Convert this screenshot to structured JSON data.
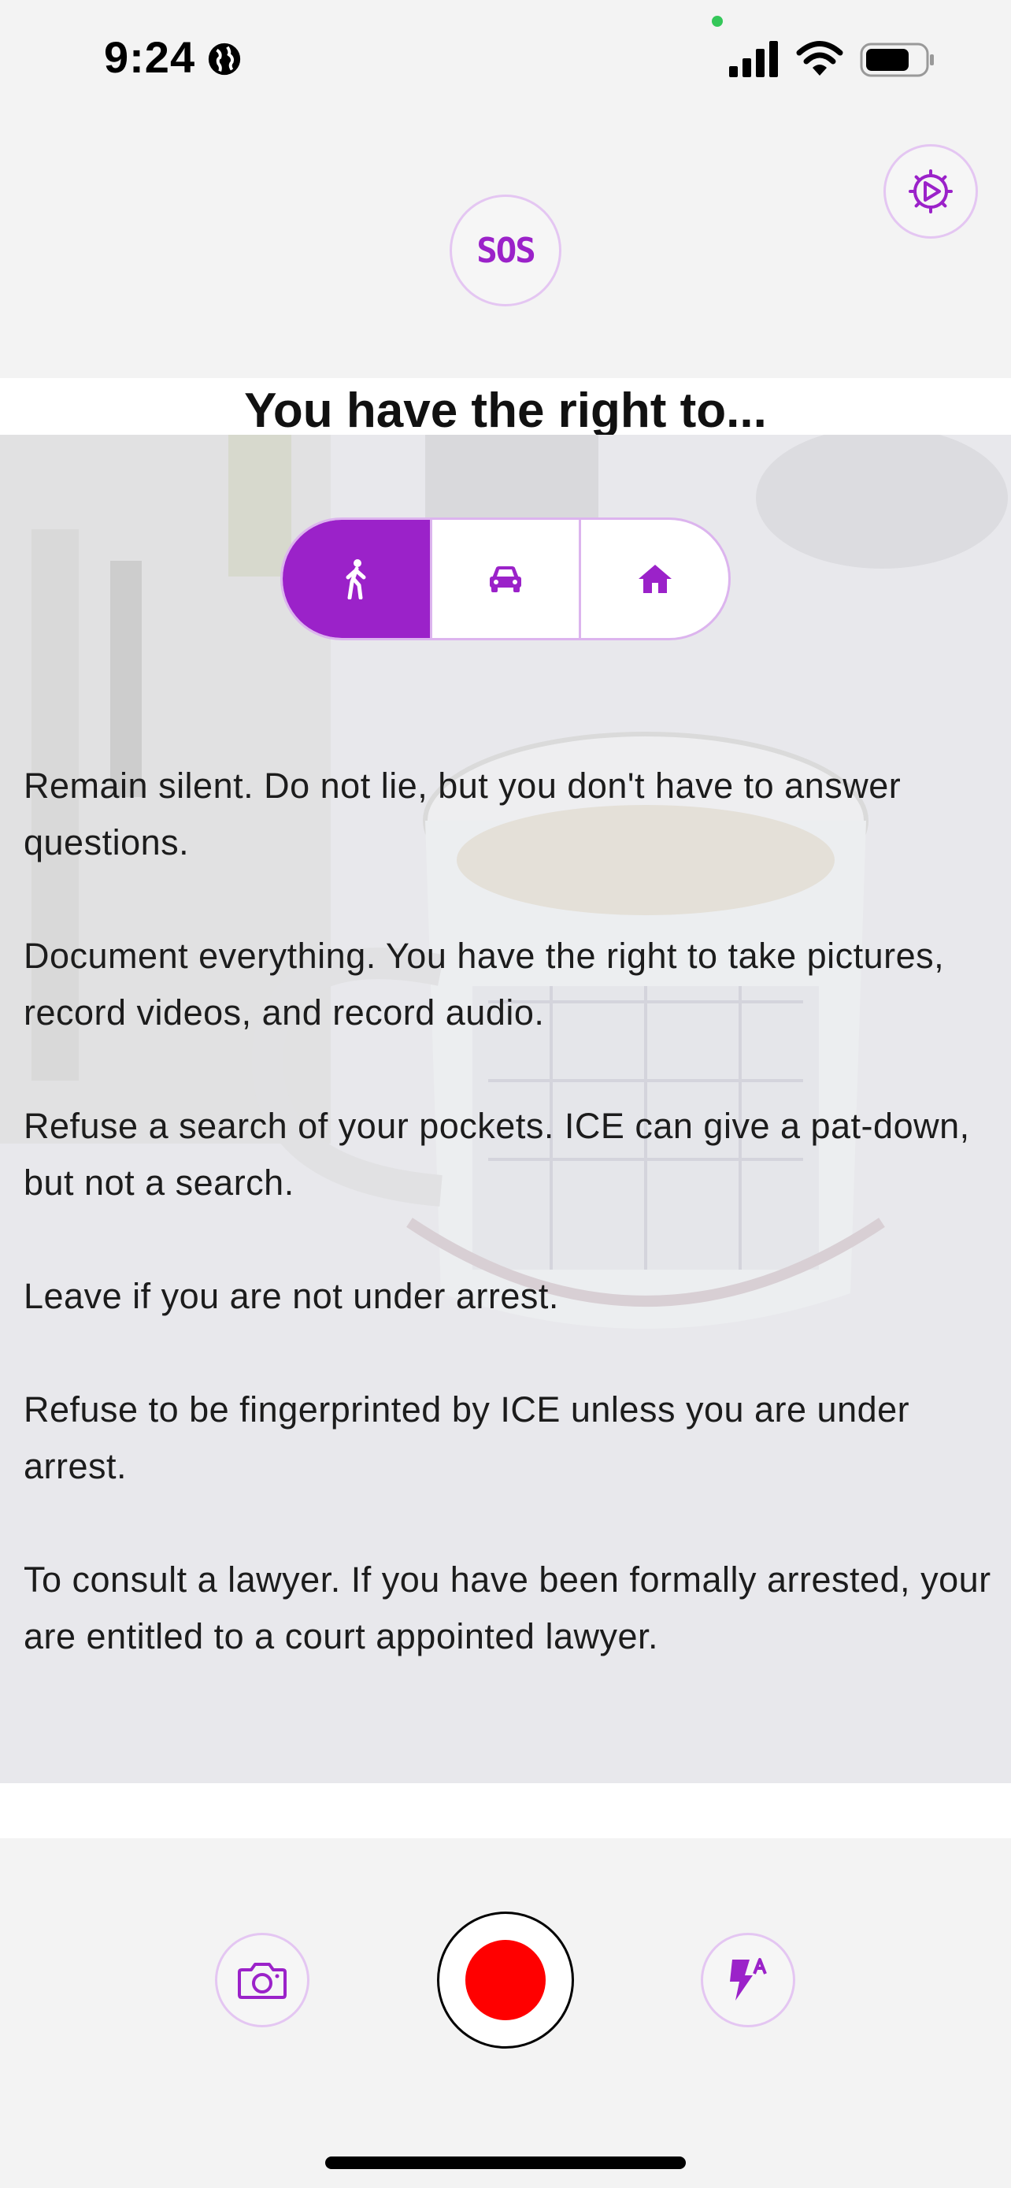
{
  "status_bar": {
    "time": "9:24",
    "icons": [
      "globe-icon",
      "signal-icon",
      "wifi-icon",
      "battery-icon"
    ]
  },
  "header": {
    "sos_label": "SOS",
    "settings_icon": "gear-icon"
  },
  "title": "You have the right to...",
  "tabs": [
    {
      "icon": "person-walking-icon",
      "active": true
    },
    {
      "icon": "car-icon",
      "active": false
    },
    {
      "icon": "house-icon",
      "active": false
    }
  ],
  "rights": [
    "Remain silent. Do not lie, but you don't have to answer questions.",
    "Document everything. You have the right to take pictures, record videos, and record audio.",
    "Refuse a search of your pockets. ICE can give a pat-down, but not a search.",
    "Leave if you are not under arrest.",
    "Refuse to be fingerprinted by ICE unless you are under arrest.",
    "To consult a lawyer. If you have been formally arrested, your are entitled to a court appointed lawyer."
  ],
  "bottom_bar": {
    "camera_icon": "camera-icon",
    "record_icon": "record-icon",
    "flash_icon": "flash-auto-icon"
  },
  "colors": {
    "accent": "#9b22c9",
    "accent_border": "#dcb4ee",
    "record": "#ff0000",
    "background": "#f3f3f3"
  }
}
